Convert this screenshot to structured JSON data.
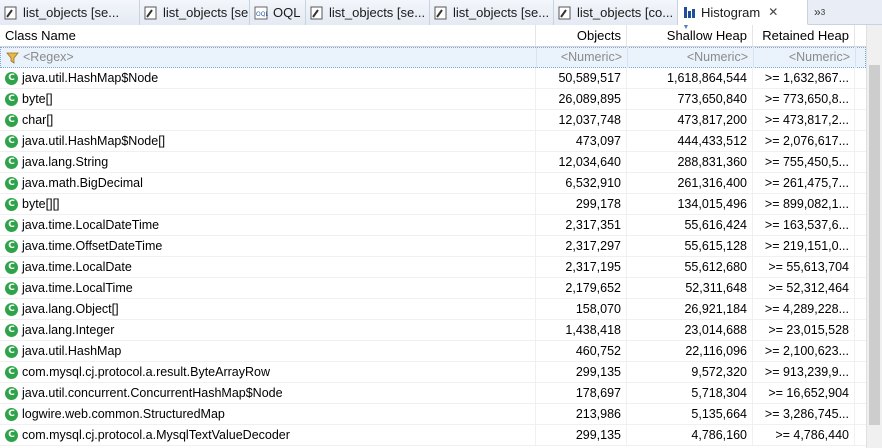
{
  "tabs": [
    {
      "label": "list_objects  [se..."
    },
    {
      "label": "list_objects  [se..."
    },
    {
      "label": "OQL"
    },
    {
      "label": "list_objects  [se..."
    },
    {
      "label": "list_objects  [se..."
    },
    {
      "label": "list_objects  [co..."
    },
    {
      "label": "Histogram",
      "close": "✕"
    }
  ],
  "overflow": {
    "chev": "»",
    "count": "3"
  },
  "columns": {
    "class_name": "Class Name",
    "objects": "Objects",
    "shallow": "Shallow Heap",
    "retained": "Retained Heap"
  },
  "filter": {
    "class_name": "<Regex>",
    "objects": "<Numeric>",
    "shallow": "<Numeric>",
    "retained": "<Numeric>"
  },
  "rows": [
    {
      "name": "java.util.HashMap$Node",
      "objects": "50,589,517",
      "shallow": "1,618,864,544",
      "retained": ">= 1,632,867..."
    },
    {
      "name": "byte[]",
      "objects": "26,089,895",
      "shallow": "773,650,840",
      "retained": ">= 773,650,8..."
    },
    {
      "name": "char[]",
      "objects": "12,037,748",
      "shallow": "473,817,200",
      "retained": ">= 473,817,2..."
    },
    {
      "name": "java.util.HashMap$Node[]",
      "objects": "473,097",
      "shallow": "444,433,512",
      "retained": ">= 2,076,617..."
    },
    {
      "name": "java.lang.String",
      "objects": "12,034,640",
      "shallow": "288,831,360",
      "retained": ">= 755,450,5..."
    },
    {
      "name": "java.math.BigDecimal",
      "objects": "6,532,910",
      "shallow": "261,316,400",
      "retained": ">= 261,475,7..."
    },
    {
      "name": "byte[][]",
      "objects": "299,178",
      "shallow": "134,015,496",
      "retained": ">= 899,082,1..."
    },
    {
      "name": "java.time.LocalDateTime",
      "objects": "2,317,351",
      "shallow": "55,616,424",
      "retained": ">= 163,537,6..."
    },
    {
      "name": "java.time.OffsetDateTime",
      "objects": "2,317,297",
      "shallow": "55,615,128",
      "retained": ">= 219,151,0..."
    },
    {
      "name": "java.time.LocalDate",
      "objects": "2,317,195",
      "shallow": "55,612,680",
      "retained": ">= 55,613,704"
    },
    {
      "name": "java.time.LocalTime",
      "objects": "2,179,652",
      "shallow": "52,311,648",
      "retained": ">= 52,312,464"
    },
    {
      "name": "java.lang.Object[]",
      "objects": "158,070",
      "shallow": "26,921,184",
      "retained": ">= 4,289,228..."
    },
    {
      "name": "java.lang.Integer",
      "objects": "1,438,418",
      "shallow": "23,014,688",
      "retained": ">= 23,015,528"
    },
    {
      "name": "java.util.HashMap",
      "objects": "460,752",
      "shallow": "22,116,096",
      "retained": ">= 2,100,623..."
    },
    {
      "name": "com.mysql.cj.protocol.a.result.ByteArrayRow",
      "objects": "299,135",
      "shallow": "9,572,320",
      "retained": ">= 913,239,9..."
    },
    {
      "name": "java.util.concurrent.ConcurrentHashMap$Node",
      "objects": "178,697",
      "shallow": "5,718,304",
      "retained": ">= 16,652,904"
    },
    {
      "name": "logwire.web.common.StructuredMap",
      "objects": "213,986",
      "shallow": "5,135,664",
      "retained": ">= 3,286,745..."
    },
    {
      "name": "com.mysql.cj.protocol.a.MysqlTextValueDecoder",
      "objects": "299,135",
      "shallow": "4,786,160",
      "retained": ">= 4,786,440"
    }
  ],
  "colors": {
    "class_icon": "#2fa34a",
    "filter_bg": "#eaf3fc",
    "tab_bg": "#e9eef6"
  }
}
